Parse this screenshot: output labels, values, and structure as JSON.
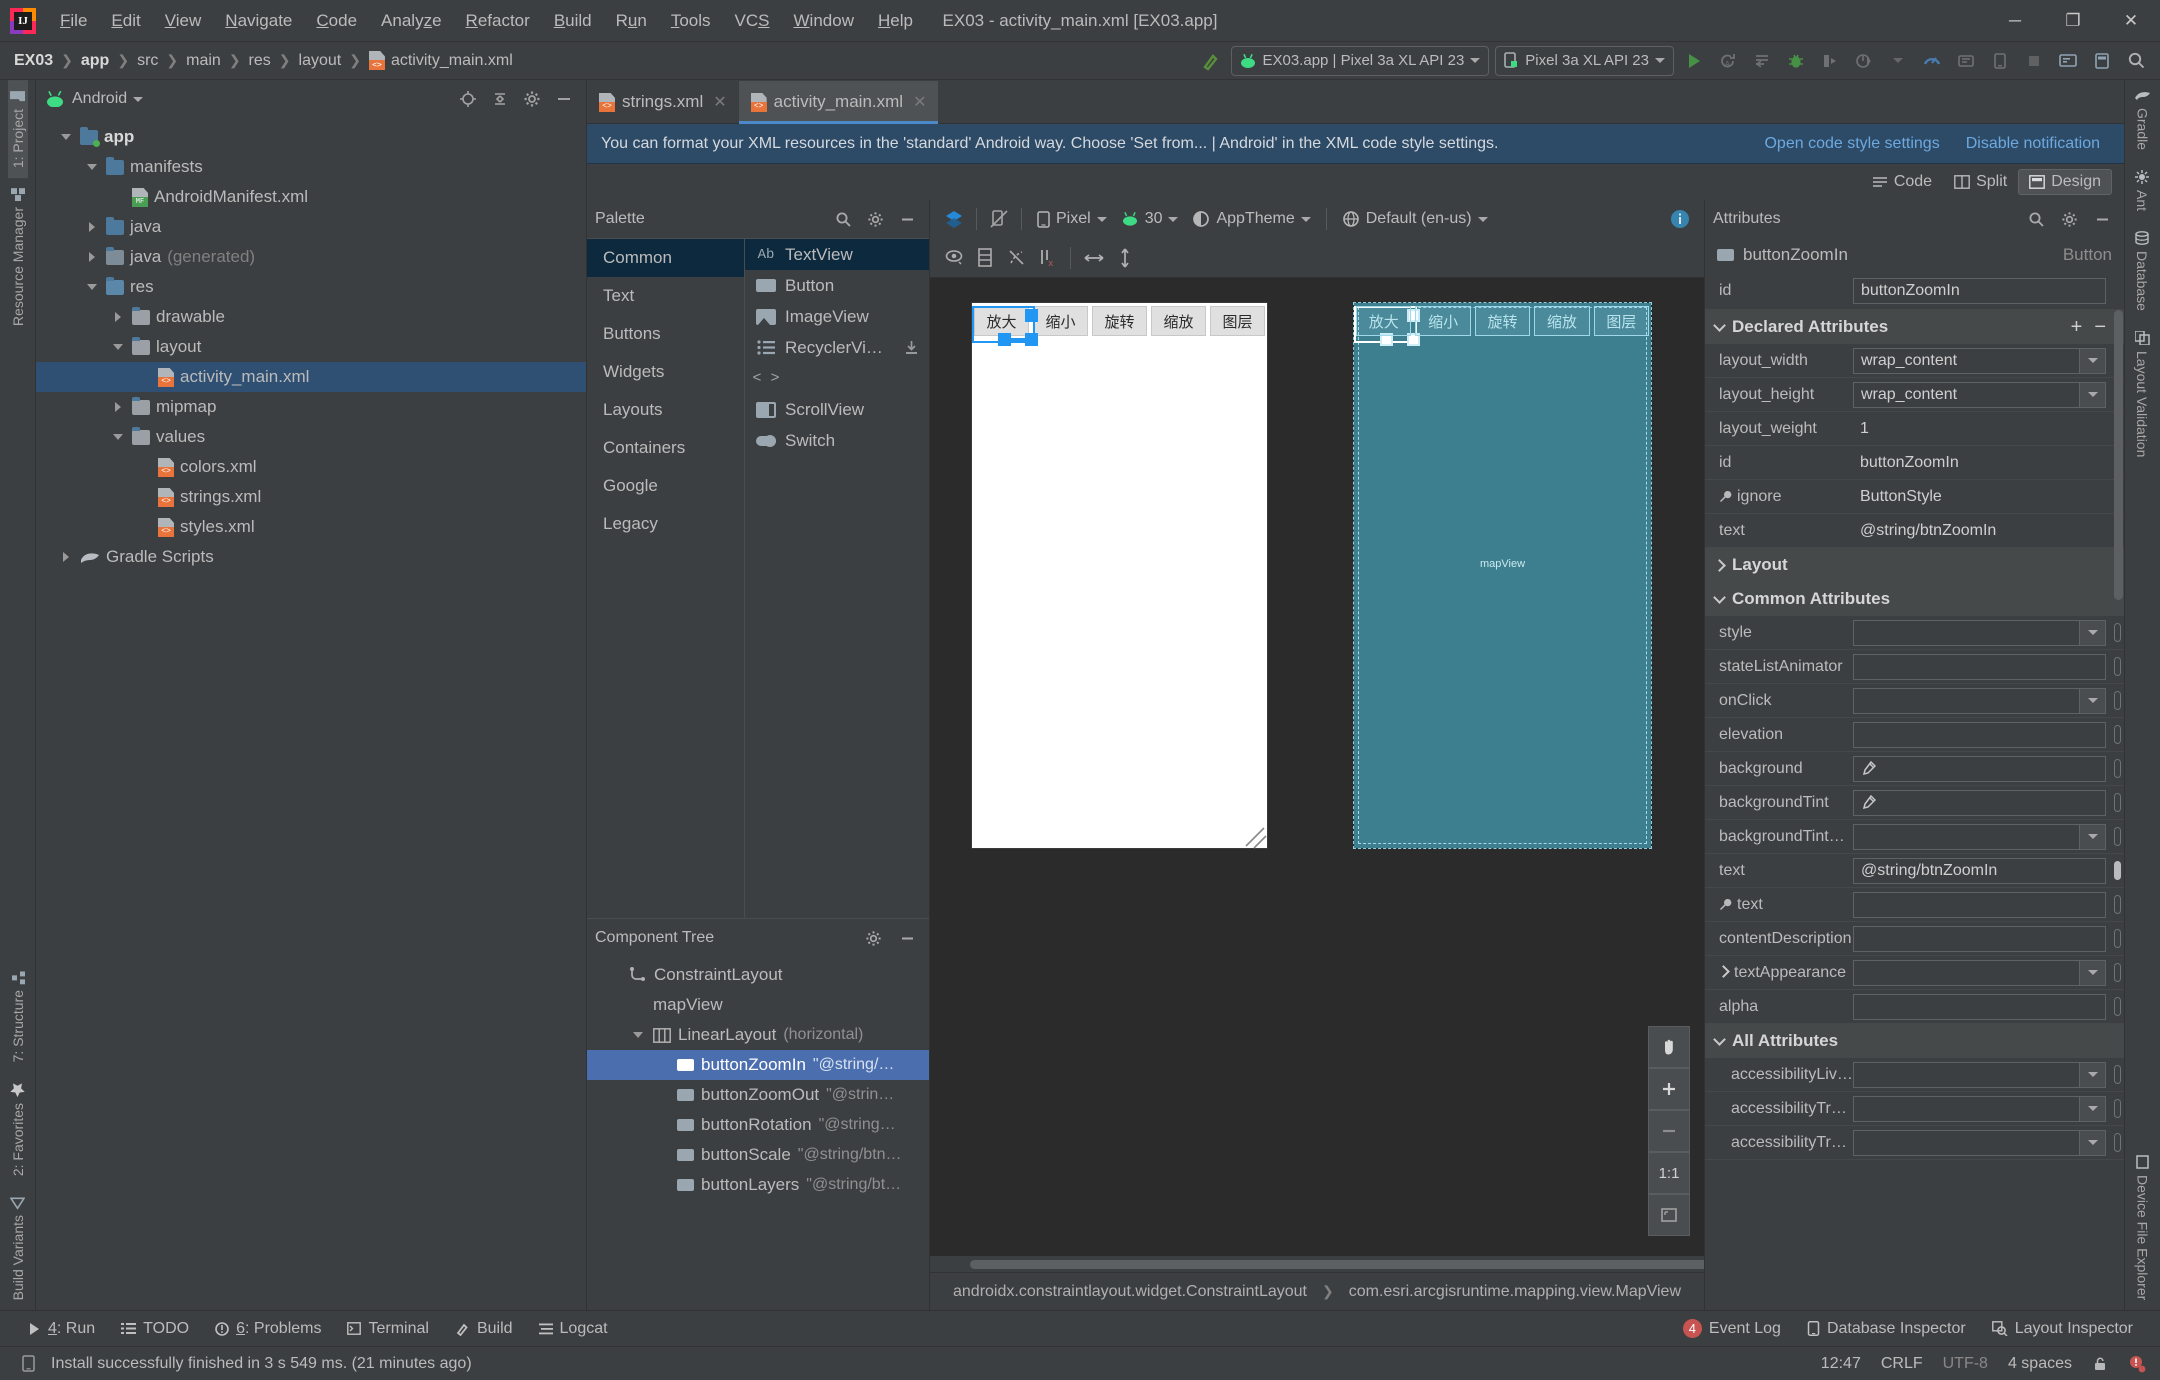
{
  "window": {
    "title": "EX03 - activity_main.xml [EX03.app]",
    "minimize": "─",
    "maximize": "❐",
    "close": "✕"
  },
  "menu": [
    {
      "label": "File",
      "accel": "F"
    },
    {
      "label": "Edit",
      "accel": "E"
    },
    {
      "label": "View",
      "accel": "V"
    },
    {
      "label": "Navigate",
      "accel": "N"
    },
    {
      "label": "Code",
      "accel": "C"
    },
    {
      "label": "Analyze",
      "accel": "z"
    },
    {
      "label": "Refactor",
      "accel": "R"
    },
    {
      "label": "Build",
      "accel": "B"
    },
    {
      "label": "Run",
      "accel": "u"
    },
    {
      "label": "Tools",
      "accel": "T"
    },
    {
      "label": "VCS",
      "accel": "S"
    },
    {
      "label": "Window",
      "accel": "W"
    },
    {
      "label": "Help",
      "accel": "H"
    }
  ],
  "breadcrumb": [
    "EX03",
    "app",
    "src",
    "main",
    "res",
    "layout",
    "activity_main.xml"
  ],
  "navbar_right": {
    "run_config": "EX03.app | Pixel 3a XL API 23",
    "device": "Pixel 3a XL API 23",
    "icons": [
      "build-hammer-icon",
      "run-icon",
      "apply-changes-icon",
      "apply-code-changes-icon",
      "debug-icon",
      "run-with-coverage-icon",
      "profile-icon",
      "profile-dropdown-icon",
      "attach-debugger-icon",
      "sdk-manager-icon",
      "avd-manager-icon",
      "stop-icon",
      "search-everywhere-icon",
      "layout-editor-icon"
    ]
  },
  "left_toolbar": [
    {
      "label": "1: Project",
      "icon": "project-icon",
      "selected": true
    },
    {
      "label": "Resource Manager",
      "icon": "resource-manager-icon",
      "selected": false
    }
  ],
  "left_toolbar_bottom": [
    {
      "label": "7: Structure",
      "icon": "structure-icon"
    },
    {
      "label": "2: Favorites",
      "icon": "star-icon"
    },
    {
      "label": "Build Variants",
      "icon": "build-variants-icon"
    }
  ],
  "right_toolbar": [
    {
      "label": "Gradle",
      "icon": "gradle-icon"
    },
    {
      "label": "Ant",
      "icon": "ant-icon"
    },
    {
      "label": "Database",
      "icon": "database-icon"
    },
    {
      "label": "Layout Validation",
      "icon": "layout-validation-icon"
    }
  ],
  "right_toolbar_bottom": [
    {
      "label": "Device File Explorer",
      "icon": "device-file-explorer-icon"
    }
  ],
  "project": {
    "header": "Android",
    "header_icons": [
      "locate-icon",
      "collapse-all-icon",
      "settings-gear-icon",
      "hide-icon"
    ],
    "tree": [
      {
        "label": "app",
        "depth": 0,
        "arrow": "open",
        "icon": "folder-module",
        "bold": true,
        "selected": false,
        "suffix": ""
      },
      {
        "label": "manifests",
        "depth": 1,
        "arrow": "open",
        "icon": "folder-blue",
        "bold": false,
        "selected": false,
        "suffix": ""
      },
      {
        "label": "AndroidManifest.xml",
        "depth": 2,
        "arrow": "none",
        "icon": "file-manifest",
        "bold": false,
        "selected": false,
        "suffix": ""
      },
      {
        "label": "java",
        "depth": 1,
        "arrow": "closed",
        "icon": "folder-blue",
        "bold": false,
        "selected": false,
        "suffix": ""
      },
      {
        "label": "java",
        "depth": 1,
        "arrow": "closed",
        "icon": "folder-gen",
        "bold": false,
        "selected": false,
        "suffix": "(generated)"
      },
      {
        "label": "res",
        "depth": 1,
        "arrow": "open",
        "icon": "folder-res",
        "bold": false,
        "selected": false,
        "suffix": ""
      },
      {
        "label": "drawable",
        "depth": 2,
        "arrow": "closed",
        "icon": "folder-gray",
        "bold": false,
        "selected": false,
        "suffix": ""
      },
      {
        "label": "layout",
        "depth": 2,
        "arrow": "open",
        "icon": "folder-gray",
        "bold": false,
        "selected": false,
        "suffix": ""
      },
      {
        "label": "activity_main.xml",
        "depth": 3,
        "arrow": "none",
        "icon": "file-xml",
        "bold": false,
        "selected": true,
        "suffix": ""
      },
      {
        "label": "mipmap",
        "depth": 2,
        "arrow": "closed",
        "icon": "folder-gray",
        "bold": false,
        "selected": false,
        "suffix": ""
      },
      {
        "label": "values",
        "depth": 2,
        "arrow": "open",
        "icon": "folder-gray",
        "bold": false,
        "selected": false,
        "suffix": ""
      },
      {
        "label": "colors.xml",
        "depth": 3,
        "arrow": "none",
        "icon": "file-xml",
        "bold": false,
        "selected": false,
        "suffix": ""
      },
      {
        "label": "strings.xml",
        "depth": 3,
        "arrow": "none",
        "icon": "file-xml",
        "bold": false,
        "selected": false,
        "suffix": ""
      },
      {
        "label": "styles.xml",
        "depth": 3,
        "arrow": "none",
        "icon": "file-xml",
        "bold": false,
        "selected": false,
        "suffix": ""
      },
      {
        "label": "Gradle Scripts",
        "depth": 0,
        "arrow": "closed",
        "icon": "gradle-elephant",
        "bold": false,
        "selected": false,
        "suffix": ""
      }
    ]
  },
  "editor_tabs": [
    {
      "label": "strings.xml",
      "active": false
    },
    {
      "label": "activity_main.xml",
      "active": true
    }
  ],
  "notification": {
    "text": "You can format your XML resources in the 'standard' Android way. Choose 'Set from... | Android' in the XML code style settings.",
    "link1": "Open code style settings",
    "link2": "Disable notification"
  },
  "mode_bar": [
    {
      "label": "Code",
      "selected": false,
      "icon": "code-icon"
    },
    {
      "label": "Split",
      "selected": false,
      "icon": "split-icon"
    },
    {
      "label": "Design",
      "selected": true,
      "icon": "design-icon"
    }
  ],
  "palette": {
    "header": "Palette",
    "header_icons": [
      "search-icon",
      "settings-gear-icon",
      "hide-icon"
    ],
    "groups": [
      {
        "label": "Common",
        "selected": true
      },
      {
        "label": "Text",
        "selected": false
      },
      {
        "label": "Buttons",
        "selected": false
      },
      {
        "label": "Widgets",
        "selected": false
      },
      {
        "label": "Layouts",
        "selected": false
      },
      {
        "label": "Containers",
        "selected": false
      },
      {
        "label": "Google",
        "selected": false
      },
      {
        "label": "Legacy",
        "selected": false
      }
    ],
    "items": [
      {
        "label": "TextView",
        "icon": "ab-textview-icon",
        "selected": true,
        "download": false
      },
      {
        "label": "Button",
        "icon": "button-icon",
        "selected": false,
        "download": false
      },
      {
        "label": "ImageView",
        "icon": "imageview-icon",
        "selected": false,
        "download": false
      },
      {
        "label": "RecyclerVi…",
        "icon": "recyclerview-icon",
        "selected": false,
        "download": true
      },
      {
        "label": "<fragment>",
        "icon": "fragment-icon",
        "selected": false,
        "download": false
      },
      {
        "label": "ScrollView",
        "icon": "scrollview-icon",
        "selected": false,
        "download": false
      },
      {
        "label": "Switch",
        "icon": "switch-icon",
        "selected": false,
        "download": false
      }
    ]
  },
  "component_tree": {
    "header": "Component Tree",
    "header_icons": [
      "settings-gear-icon",
      "hide-icon"
    ],
    "nodes": [
      {
        "label": "ConstraintLayout",
        "sub": "",
        "depth": 0,
        "arrow": "none",
        "icon": "constraintlayout-icon",
        "selected": false
      },
      {
        "label": "mapView",
        "sub": "",
        "depth": 1,
        "arrow": "none",
        "icon": "none",
        "selected": false
      },
      {
        "label": "LinearLayout",
        "sub": "(horizontal)",
        "depth": 1,
        "arrow": "open",
        "icon": "linearlayout-icon",
        "selected": false
      },
      {
        "label": "buttonZoomIn",
        "sub": "\"@string/…",
        "depth": 2,
        "arrow": "none",
        "icon": "button-icon",
        "selected": true
      },
      {
        "label": "buttonZoomOut",
        "sub": "\"@strin…",
        "depth": 2,
        "arrow": "none",
        "icon": "button-icon",
        "selected": false
      },
      {
        "label": "buttonRotation",
        "sub": "\"@string…",
        "depth": 2,
        "arrow": "none",
        "icon": "button-icon",
        "selected": false
      },
      {
        "label": "buttonScale",
        "sub": "\"@string/btn…",
        "depth": 2,
        "arrow": "none",
        "icon": "button-icon",
        "selected": false
      },
      {
        "label": "buttonLayers",
        "sub": "\"@string/bt…",
        "depth": 2,
        "arrow": "none",
        "icon": "button-icon",
        "selected": false
      }
    ]
  },
  "surface_toolbar": {
    "design_mode_icon": "design-surface-mode-icon",
    "orientation_icon": "orientation-icon",
    "device": "Pixel",
    "api": "30",
    "theme": "AppTheme",
    "locale": "Default (en-us)",
    "info_icon": "info-icon",
    "row2_icons": [
      "show-constraints-icon",
      "autoconnect-icon",
      "clear-constraints-icon",
      "infer-constraints-icon",
      "match-width-icon",
      "match-height-icon"
    ]
  },
  "preview": {
    "buttons": [
      "放大",
      "缩小",
      "旋转",
      "缩放",
      "图层"
    ],
    "map_label": "mapView",
    "selected_button_index": 0,
    "canvas_tools": [
      "pan-hand-icon",
      "zoom-in-icon",
      "zoom-out-icon",
      "zoom-to-fit-icon",
      "zoom-actual-icon"
    ],
    "zoom_actual_label": "1:1"
  },
  "surface_breadcrumb": [
    "androidx.constraintlayout.widget.ConstraintLayout",
    "com.esri.arcgisruntime.mapping.view.MapView"
  ],
  "attributes": {
    "header": "Attributes",
    "header_icons": [
      "search-icon",
      "settings-gear-icon",
      "hide-icon"
    ],
    "component_name": "buttonZoomIn",
    "component_type": "Button",
    "id_label": "id",
    "id_value": "buttonZoomIn",
    "sections": [
      {
        "title": "Declared Attributes",
        "expanded": true,
        "actions": [
          "+",
          "−"
        ],
        "rows": [
          {
            "key": "layout_width",
            "value": "wrap_content",
            "control": "dropdown",
            "pill": "empty",
            "wrench": false,
            "chevron": false
          },
          {
            "key": "layout_height",
            "value": "wrap_content",
            "control": "dropdown",
            "pill": "empty",
            "wrench": false,
            "chevron": false
          },
          {
            "key": "layout_weight",
            "value": "1",
            "control": "plain",
            "pill": "empty",
            "wrench": false,
            "chevron": false
          },
          {
            "key": "id",
            "value": "buttonZoomIn",
            "control": "plain",
            "pill": "none",
            "wrench": false,
            "chevron": false
          },
          {
            "key": "ignore",
            "value": "ButtonStyle",
            "control": "plain",
            "pill": "empty",
            "wrench": true,
            "chevron": false
          },
          {
            "key": "text",
            "value": "@string/btnZoomIn",
            "control": "plain",
            "pill": "full",
            "wrench": false,
            "chevron": false
          }
        ]
      },
      {
        "title": "Layout",
        "expanded": false,
        "actions": [],
        "rows": []
      },
      {
        "title": "Common Attributes",
        "expanded": true,
        "actions": [],
        "rows": [
          {
            "key": "style",
            "value": "",
            "control": "dropdown",
            "pill": "empty",
            "wrench": false,
            "chevron": false
          },
          {
            "key": "stateListAnimator",
            "value": "",
            "control": "text",
            "pill": "empty",
            "wrench": false,
            "chevron": false
          },
          {
            "key": "onClick",
            "value": "",
            "control": "dropdown",
            "pill": "empty",
            "wrench": false,
            "chevron": false
          },
          {
            "key": "elevation",
            "value": "",
            "control": "text",
            "pill": "empty",
            "wrench": false,
            "chevron": false
          },
          {
            "key": "background",
            "value": "",
            "control": "picker",
            "pill": "empty",
            "wrench": false,
            "chevron": false
          },
          {
            "key": "backgroundTint",
            "value": "",
            "control": "picker",
            "pill": "empty",
            "wrench": false,
            "chevron": false
          },
          {
            "key": "backgroundTint…",
            "value": "",
            "control": "dropdown",
            "pill": "empty",
            "wrench": false,
            "chevron": false
          },
          {
            "key": "text",
            "value": "@string/btnZoomIn",
            "control": "text",
            "pill": "full",
            "wrench": false,
            "chevron": false
          },
          {
            "key": "text",
            "value": "",
            "control": "text",
            "pill": "empty",
            "wrench": true,
            "chevron": false
          },
          {
            "key": "contentDescription",
            "value": "",
            "control": "text",
            "pill": "empty",
            "wrench": false,
            "chevron": false
          },
          {
            "key": "textAppearance",
            "value": "",
            "control": "dropdown",
            "pill": "empty",
            "wrench": false,
            "chevron": true
          },
          {
            "key": "alpha",
            "value": "",
            "control": "text",
            "pill": "empty",
            "wrench": false,
            "chevron": false
          }
        ]
      },
      {
        "title": "All Attributes",
        "expanded": true,
        "actions": [],
        "rows": [
          {
            "key": "accessibilityLive…",
            "value": "",
            "control": "dropdown",
            "pill": "empty",
            "wrench": false,
            "chevron": false
          },
          {
            "key": "accessibilityTrav…",
            "value": "",
            "control": "dropdown",
            "pill": "empty",
            "wrench": false,
            "chevron": false
          },
          {
            "key": "accessibilityTrav…",
            "value": "",
            "control": "dropdown",
            "pill": "empty",
            "wrench": false,
            "chevron": false
          }
        ]
      }
    ]
  },
  "tool_window_bar": {
    "left": [
      {
        "label": "4: Run",
        "accel": "4",
        "icon": "run-icon"
      },
      {
        "label": "TODO",
        "accel": "",
        "icon": "todo-icon"
      },
      {
        "label": "6: Problems",
        "accel": "6",
        "icon": "problems-icon"
      },
      {
        "label": "Terminal",
        "accel": "",
        "icon": "terminal-icon"
      },
      {
        "label": "Build",
        "accel": "",
        "icon": "build-icon"
      },
      {
        "label": "Logcat",
        "accel": "",
        "icon": "logcat-icon"
      }
    ],
    "right": [
      {
        "label": "Event Log",
        "badge": "4",
        "icon": "event-log-icon"
      },
      {
        "label": "Database Inspector",
        "badge": "",
        "icon": "database-inspector-icon"
      },
      {
        "label": "Layout Inspector",
        "badge": "",
        "icon": "layout-inspector-icon"
      }
    ]
  },
  "status_bar": {
    "message": "Install successfully finished in 3 s 549 ms. (21 minutes ago)",
    "icon": "device-icon",
    "right": [
      "12:47",
      "CRLF",
      "UTF-8",
      "4 spaces"
    ],
    "lock_icon": "lock-icon",
    "inspection_icon": "inspection-icon"
  },
  "colors": {
    "accent": "#4a88c7",
    "selection": "#4b6eaf",
    "tree_selection": "#2f5073",
    "notification_bg": "#2d4a66",
    "blueprint": "#3d7f8f",
    "canvas": "#2b2b2b",
    "handle": "#2196f3"
  }
}
